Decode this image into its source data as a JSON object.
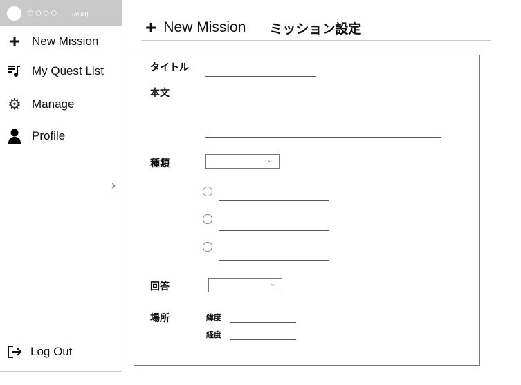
{
  "sidebar": {
    "user_name": "○○○○",
    "user_role": "(Artist)",
    "items": [
      {
        "label": "New Mission",
        "icon": "plus-icon"
      },
      {
        "label": "My Quest List",
        "icon": "playlist-music-icon"
      },
      {
        "label": "Manage",
        "icon": "gear-manage-icon"
      },
      {
        "label": "Profile",
        "icon": "person-icon"
      }
    ],
    "logout": "Log Out"
  },
  "header": {
    "title": "New Mission",
    "subtitle": "ミッション設定"
  },
  "form": {
    "title_label": "タイトル",
    "body_label": "本文",
    "type_label": "種類",
    "answer_label": "回答",
    "location_label": "場所",
    "latitude_label": "緯度",
    "longitude_label": "経度",
    "type_value": "",
    "answer_value": ""
  }
}
